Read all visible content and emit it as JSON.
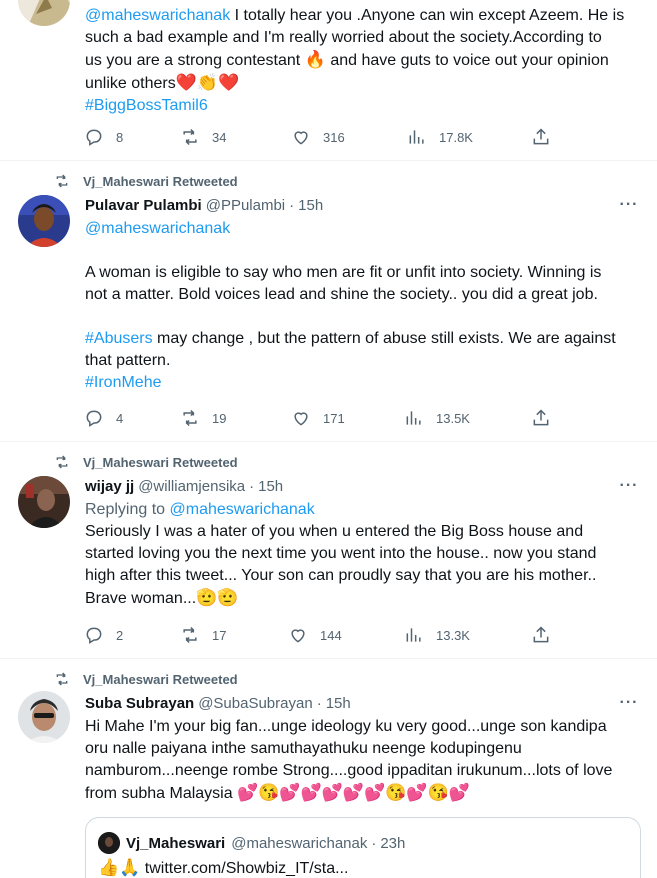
{
  "tweets": [
    {
      "id": "t0",
      "body_line1_mention": "@maheswarichanak",
      "body_line1_rest": " I totally hear you .Anyone can win except Azeem. He is",
      "body_line2": "such a bad example and I'm really worried about the society.According to",
      "body_line3": "us you are a  strong contestant",
      "body_line3_emoji": "🔥",
      "body_line3_rest": " and have guts to voice out your opinion",
      "body_line4": "unlike others",
      "body_line4_emoji": "❤️👏❤️",
      "hashtag": "#BiggBossTamil6",
      "replies": "8",
      "retweets": "34",
      "likes": "316",
      "views": "17.8K"
    },
    {
      "id": "t1",
      "retweeted_by": "Vj_Maheswari Retweeted",
      "name": "Pulavar Pulambi",
      "handle": "@PPulambi",
      "sep": "·",
      "time": "15h",
      "mention": "@maheswarichanak",
      "para1_line1": "A woman is eligible to say who men are fit or unfit into society. Winning is",
      "para1_line2": "not a matter. Bold voices lead and shine  the society.. you did a great job.",
      "para2_hashtag": "#Abusers",
      "para2_line1_rest": " may change , but the pattern of abuse still exists. We are against",
      "para2_line2": "that pattern.",
      "hashtag2": "#IronMehe",
      "replies": "4",
      "retweets": "19",
      "likes": "171",
      "views": "13.5K"
    },
    {
      "id": "t2",
      "retweeted_by": "Vj_Maheswari Retweeted",
      "name": "wijay jj",
      "handle": "@williamjensika",
      "sep": "·",
      "time": "15h",
      "replying_prefix": "Replying to ",
      "replying_to": "@maheswarichanak",
      "line1": "Seriously I was a hater of you when u entered the Big Boss house and",
      "line2": "started loving you the next time you went into the house.. now you stand",
      "line3": "high after this tweet... Your son can proudly say that you are his mother..",
      "line4": "Brave woman...",
      "line4_emoji": "🫡🫡",
      "replies": "2",
      "retweets": "17",
      "likes": "144",
      "views": "13.3K"
    },
    {
      "id": "t3",
      "retweeted_by": "Vj_Maheswari Retweeted",
      "name": "Suba Subrayan",
      "handle": "@SubaSubrayan",
      "sep": "·",
      "time": "15h",
      "line1": "Hi Mahe I'm your big fan...unge ideology ku very good...unge son kandipa",
      "line2": "oru nalle paiyana inthe samuthayathuku neenge kodupingenu",
      "line3": "namburom...neenge rombe Strong....good ippaditan irukunum...lots of love",
      "line4": "from subha Malaysia",
      "line4_emoji": "💕😘💕💕💕💕💕😘💕😘💕",
      "quote": {
        "name": "Vj_Maheswari",
        "handle": "@maheswarichanak",
        "sep": "·",
        "time": "23h",
        "emoji": "👍🙏",
        "link": "twitter.com/Showbiz_IT/sta..."
      }
    }
  ],
  "colors": {
    "link": "#1d9bf0",
    "muted": "#536471",
    "text": "#0f1419",
    "divider": "#eff3f4"
  },
  "icons": [
    "reply-icon",
    "retweet-icon",
    "like-icon",
    "views-icon",
    "share-icon",
    "more-icon"
  ]
}
